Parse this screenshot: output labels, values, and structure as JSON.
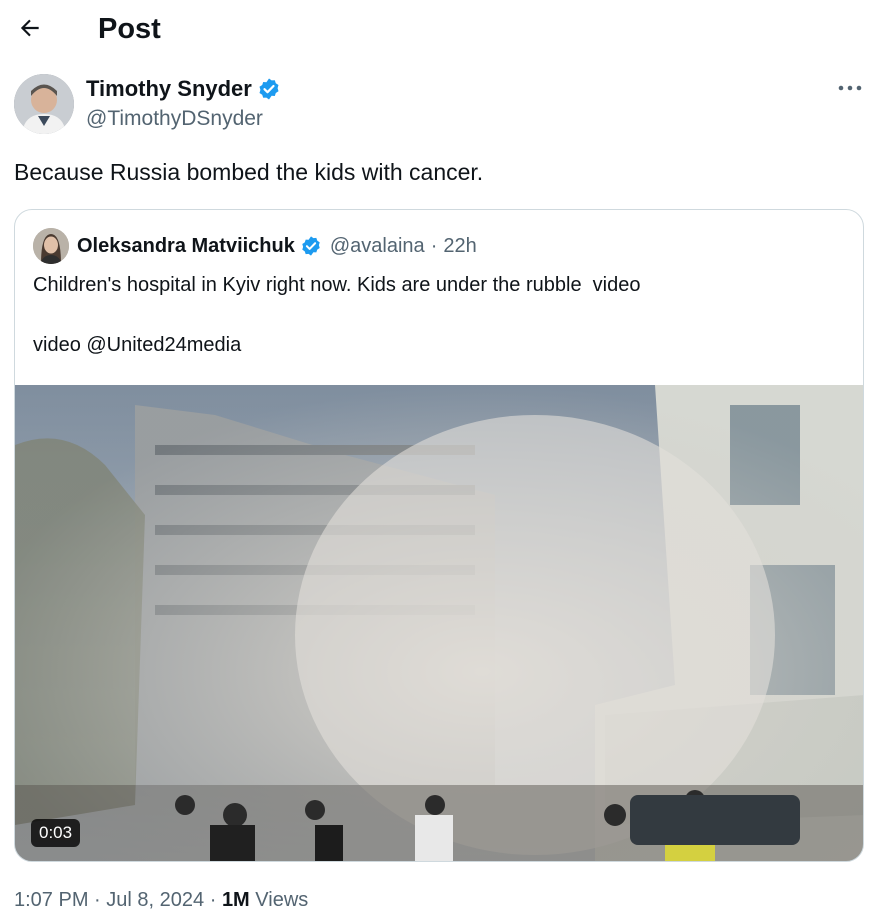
{
  "header": {
    "title": "Post",
    "back_icon": "arrow-left-icon"
  },
  "post": {
    "author_name": "Timothy Snyder",
    "author_handle": "@TimothyDSnyder",
    "verified_color": "#1d9bf0",
    "text": "Because Russia bombed the kids with cancer.",
    "more_icon": "more-horizontal-icon"
  },
  "quote": {
    "author_name": "Oleksandra Matviichuk",
    "author_handle": "@avalaina",
    "separator": "·",
    "time": "22h",
    "text": "Children's hospital in Kyiv right now. Kids are under the rubble  video\n\nvideo @United24media",
    "video_duration": "0:03"
  },
  "meta": {
    "time": "1:07 PM",
    "sep1": "·",
    "date": "Jul 8, 2024",
    "sep2": "·",
    "views_count": "1M",
    "views_label": "Views"
  },
  "colors": {
    "text": "#0f1419",
    "secondary": "#536471",
    "border": "#cfd9de",
    "verified": "#1d9bf0"
  }
}
